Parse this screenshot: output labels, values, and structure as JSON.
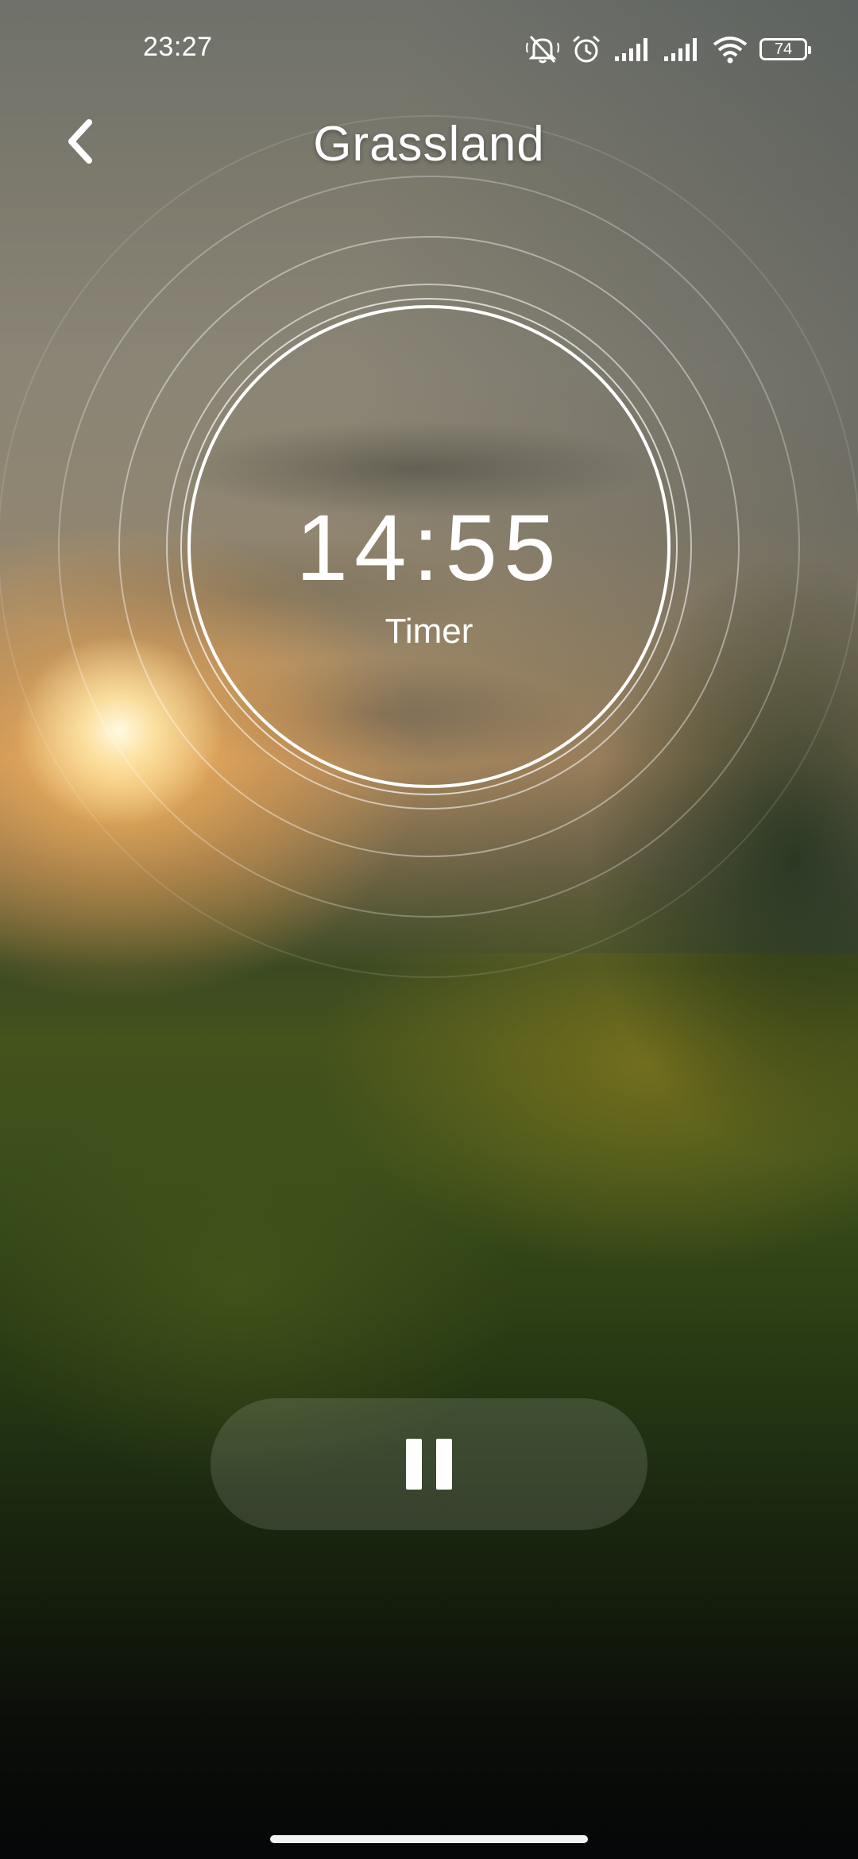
{
  "status_bar": {
    "time": "23:27",
    "battery_level": "74",
    "icons": [
      "mute-icon",
      "alarm-icon",
      "signal-icon",
      "signal-icon",
      "wifi-icon",
      "battery-icon"
    ]
  },
  "header": {
    "back_icon": "chevron-left-icon",
    "title": "Grassland"
  },
  "timer": {
    "value": "14:55",
    "label": "Timer"
  },
  "controls": {
    "pause_icon": "pause-icon"
  },
  "colors": {
    "text": "#ffffff",
    "pill_background": "rgba(255,255,255,0.13)"
  }
}
